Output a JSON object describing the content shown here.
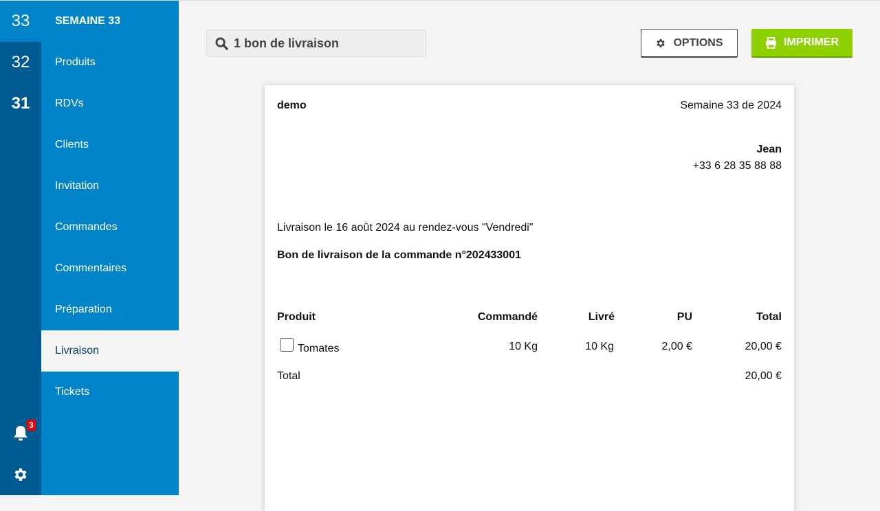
{
  "weeks": [
    {
      "label": "33"
    },
    {
      "label": "32"
    },
    {
      "label": "31"
    }
  ],
  "notifications": {
    "count": "3"
  },
  "menu": {
    "title": "SEMAINE 33",
    "items": [
      "Produits",
      "RDVs",
      "Clients",
      "Invitation",
      "Commandes",
      "Commentaires",
      "Préparation",
      "Livraison",
      "Tickets"
    ],
    "active": "Livraison"
  },
  "search": {
    "value": "1 bon de livraison"
  },
  "toolbar": {
    "options": "OPTIONS",
    "print": "IMPRIMER"
  },
  "doc": {
    "producer": "demo",
    "week": "Semaine 33 de 2024",
    "client_name": "Jean",
    "client_phone": "+33 6 28 35 88 88",
    "delivery": "Livraison le 16 août 2024 au rendez-vous \"Vendredi\"",
    "order_title": "Bon de livraison de la commande n°202433001",
    "headers": [
      "Produit",
      "Commandé",
      "Livré",
      "PU",
      "Total"
    ],
    "rows": [
      {
        "product": "Tomates",
        "ordered": "10 Kg",
        "delivered": "10 Kg",
        "unit_price": "2,00 €",
        "total": "20,00 €"
      }
    ],
    "total_label": "Total",
    "total_value": "20,00 €"
  }
}
